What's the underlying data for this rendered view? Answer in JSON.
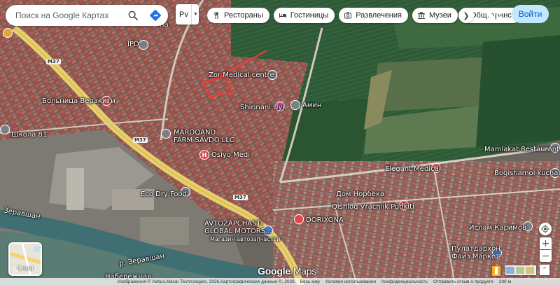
{
  "search": {
    "placeholder": "Поиск на Google Картах"
  },
  "layer_button": {
    "label": "Рv"
  },
  "chips": [
    {
      "label": "Рестораны",
      "icon": "fork-knife-icon"
    },
    {
      "label": "Гостиницы",
      "icon": "bed-icon"
    },
    {
      "label": "Развлечения",
      "icon": "camera-icon"
    },
    {
      "label": "Музеи",
      "icon": "museum-icon"
    },
    {
      "label": "Общ. транс",
      "icon": "bus-icon"
    }
  ],
  "signin": {
    "label": "Войти"
  },
  "layer_thumb": {
    "label": "Слои"
  },
  "map_labels": {
    "ipd": "IPD",
    "medical": "Zor Medical centre",
    "hospital": "Больница Веракити",
    "school": "Школа 81",
    "maroqand": "MAROQAND\nFARM SAVDO LLC",
    "osiyo": "Osiyo Medi",
    "shirinani": "Shirinani Uyi",
    "amin": "Амин",
    "mamlakat": "Mamlakat Restaurant",
    "elegant": "Elegant Medical",
    "bogishamol": "Bogishamol kuchasi",
    "dom": "Дом Норбека",
    "qishloq": "Qishloq Vrachlik Punkiti",
    "dorixona": "DORIXONA",
    "ecodry": "Eco Dry Food",
    "avtoz": "AVTOZAPCHASTI\nGLOBAL MOTORS...",
    "magazin": "Магазин автозапчастей",
    "islam": "Ислам Каримов",
    "pulat": "Пулатдархон\nФаиз Маркет",
    "zeravshan1": "Зеравшан",
    "zeravshan2": "р. Зеравшан",
    "naberezh": "Набережная",
    "kh_partial": "на"
  },
  "road_shields": [
    "M37",
    "M37",
    "M37"
  ],
  "footer": {
    "imagery": "Изображения © Airbus,Maxar Technologies, 2026,Картографические данные ©, 2026",
    "country": "Весь мир",
    "terms": "Условия использования",
    "privacy": "Конфиденциальность",
    "feedback": "Отправить отзыв о продукте",
    "scale": "200 м"
  },
  "colors": {
    "signin_bg": "#c2e7ff",
    "signin_text": "#0b57d0",
    "road_yellow": "#e8cf6a",
    "pin_red": "#e0464b"
  }
}
